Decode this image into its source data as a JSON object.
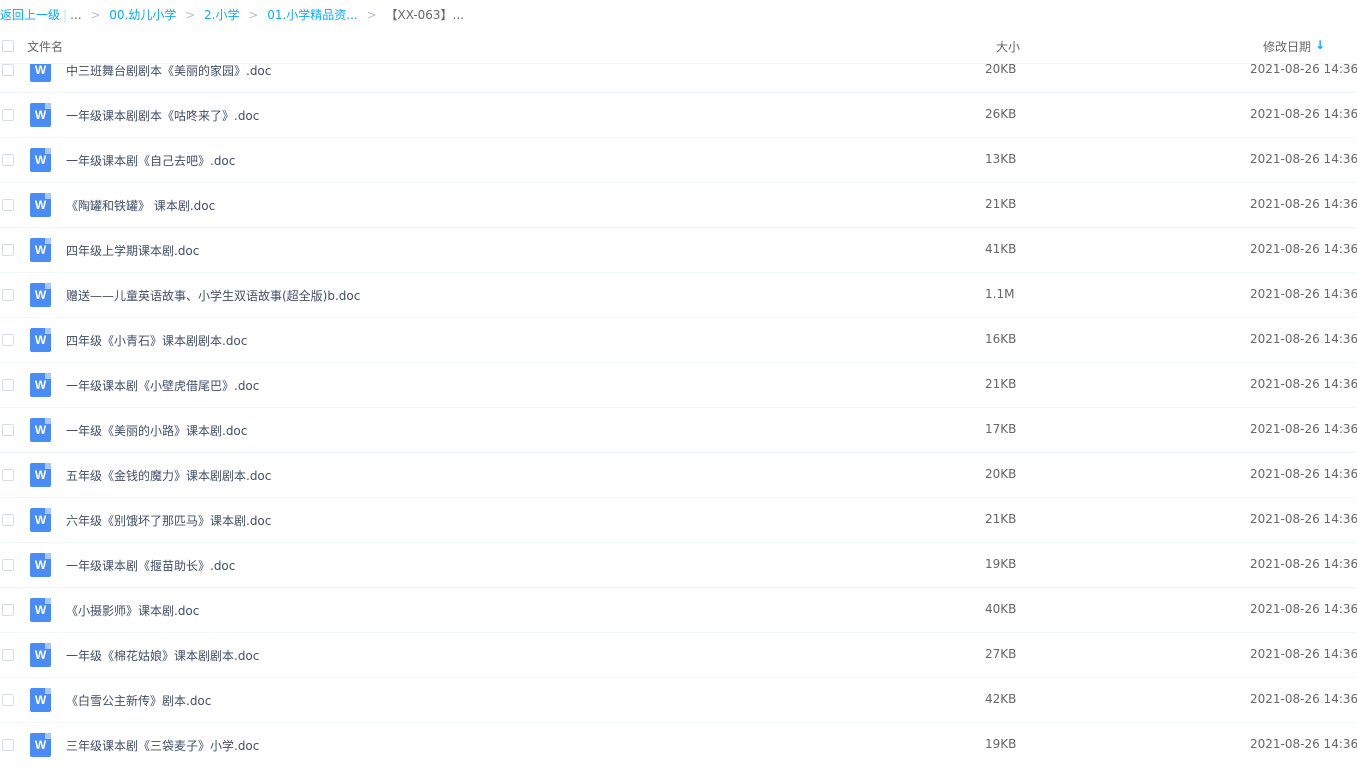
{
  "breadcrumb": {
    "back": "返回上一级",
    "divider": "|",
    "ellipsis": "...",
    "items": [
      "00.幼儿小学",
      "2.小学",
      "01.小学精品资..."
    ],
    "current": "【XX-063】..."
  },
  "header": {
    "name": "文件名",
    "size": "大小",
    "date": "修改日期",
    "sort_icon": "↓"
  },
  "files": [
    {
      "icon": "W",
      "name": "中三班舞台剧剧本《美丽的家园》.doc",
      "size": "20KB",
      "date": "2021-08-26 14:36"
    },
    {
      "icon": "W",
      "name": "一年级课本剧剧本《咕咚来了》.doc",
      "size": "26KB",
      "date": "2021-08-26 14:36"
    },
    {
      "icon": "W",
      "name": "一年级课本剧《自己去吧》.doc",
      "size": "13KB",
      "date": "2021-08-26 14:36"
    },
    {
      "icon": "W",
      "name": "《陶罐和铁罐》 课本剧.doc",
      "size": "21KB",
      "date": "2021-08-26 14:36"
    },
    {
      "icon": "W",
      "name": "四年级上学期课本剧.doc",
      "size": "41KB",
      "date": "2021-08-26 14:36"
    },
    {
      "icon": "W",
      "name": "赠送——儿童英语故事、小学生双语故事(超全版)b.doc",
      "size": "1.1M",
      "date": "2021-08-26 14:36"
    },
    {
      "icon": "W",
      "name": "四年级《小青石》课本剧剧本.doc",
      "size": "16KB",
      "date": "2021-08-26 14:36"
    },
    {
      "icon": "W",
      "name": "一年级课本剧《小壁虎借尾巴》.doc",
      "size": "21KB",
      "date": "2021-08-26 14:36"
    },
    {
      "icon": "W",
      "name": "一年级《美丽的小路》课本剧.doc",
      "size": "17KB",
      "date": "2021-08-26 14:36"
    },
    {
      "icon": "W",
      "name": "五年级《金钱的魔力》课本剧剧本.doc",
      "size": "20KB",
      "date": "2021-08-26 14:36"
    },
    {
      "icon": "W",
      "name": "六年级《别饿坏了那匹马》课本剧.doc",
      "size": "21KB",
      "date": "2021-08-26 14:36"
    },
    {
      "icon": "W",
      "name": "一年级课本剧《揠苗助长》.doc",
      "size": "19KB",
      "date": "2021-08-26 14:36"
    },
    {
      "icon": "W",
      "name": "《小摄影师》课本剧.doc",
      "size": "40KB",
      "date": "2021-08-26 14:36"
    },
    {
      "icon": "W",
      "name": "一年级《棉花姑娘》课本剧剧本.doc",
      "size": "27KB",
      "date": "2021-08-26 14:36"
    },
    {
      "icon": "W",
      "name": "《白雪公主新传》剧本.doc",
      "size": "42KB",
      "date": "2021-08-26 14:36"
    },
    {
      "icon": "W",
      "name": "三年级课本剧《三袋麦子》小学.doc",
      "size": "19KB",
      "date": "2021-08-26 14:36"
    }
  ]
}
